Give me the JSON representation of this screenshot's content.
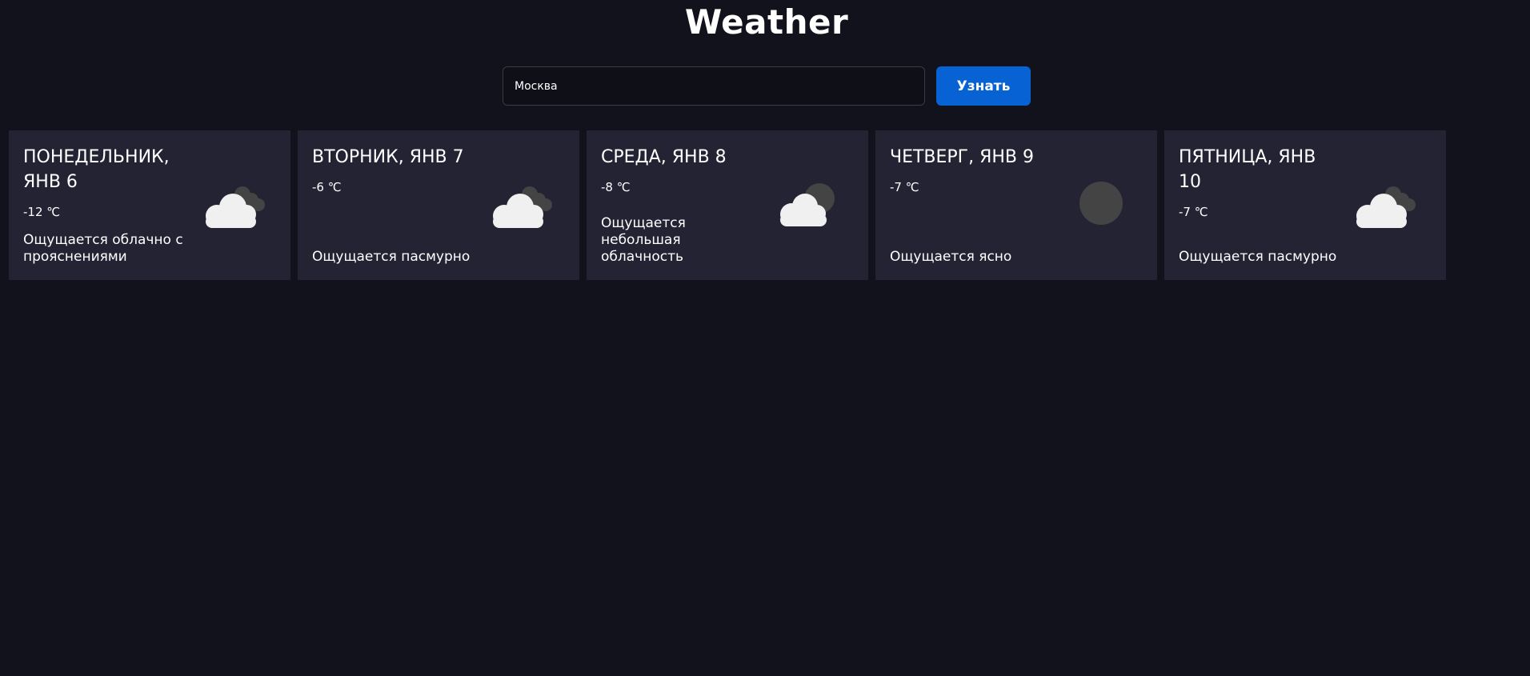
{
  "header": {
    "title": "Weather"
  },
  "search": {
    "value": "Москва",
    "button_label": "Узнать"
  },
  "forecast": [
    {
      "date": "ПОНЕДЕЛЬНИК, ЯНВ 6",
      "temp": "-12 ℃",
      "description": "Ощущается облачно с прояснениями",
      "icon": "partly-cloudy-icon"
    },
    {
      "date": "ВТОРНИК, ЯНВ 7",
      "temp": "-6 ℃",
      "description": "Ощущается пасмурно",
      "icon": "overcast-icon"
    },
    {
      "date": "СРЕДА, ЯНВ 8",
      "temp": "-8 ℃",
      "description": "Ощущается небольшая облачность",
      "icon": "few-clouds-icon"
    },
    {
      "date": "ЧЕТВЕРГ, ЯНВ 9",
      "temp": "-7 ℃",
      "description": "Ощущается ясно",
      "icon": "clear-night-icon"
    },
    {
      "date": "ПЯТНИЦА, ЯНВ 10",
      "temp": "-7 ℃",
      "description": "Ощущается пасмурно",
      "icon": "overcast-icon"
    }
  ],
  "colors": {
    "background": "#12121c",
    "card": "#232334",
    "accent": "#0762d4"
  }
}
